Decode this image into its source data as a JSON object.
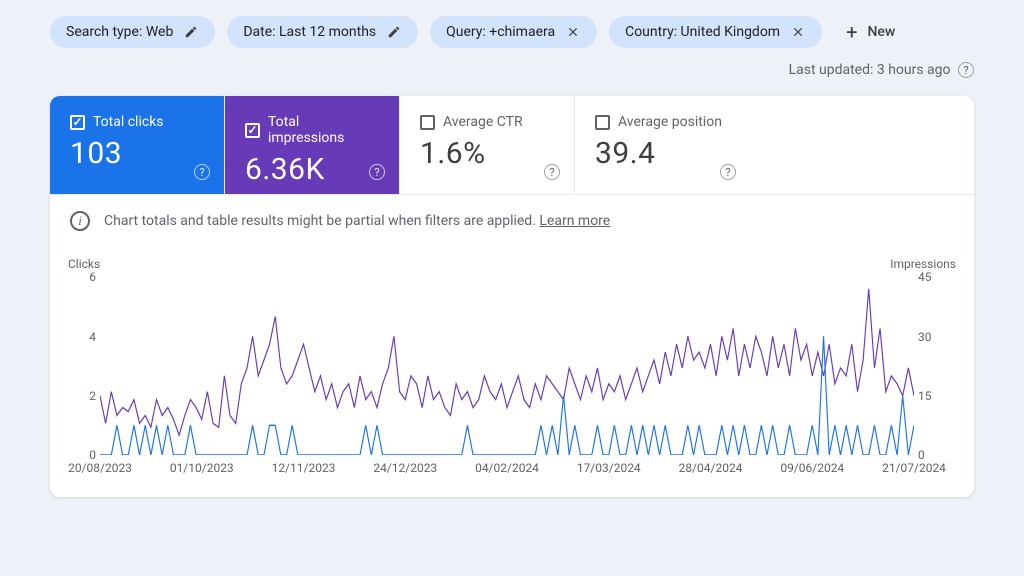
{
  "filters": [
    {
      "label": "Search type: Web",
      "icon": "edit"
    },
    {
      "label": "Date: Last 12 months",
      "icon": "edit"
    },
    {
      "label": "Query: +chimaera",
      "icon": "close"
    },
    {
      "label": "Country: United Kingdom",
      "icon": "close"
    }
  ],
  "new_btn": "New",
  "last_updated": "Last updated: 3 hours ago",
  "metrics": {
    "clicks": {
      "label": "Total clicks",
      "value": "103",
      "checked": true,
      "theme": "blue"
    },
    "impr": {
      "label": "Total impressions",
      "value": "6.36K",
      "checked": true,
      "theme": "purple"
    },
    "ctr": {
      "label": "Average CTR",
      "value": "1.6%",
      "checked": false,
      "theme": "white"
    },
    "position": {
      "label": "Average position",
      "value": "39.4",
      "checked": false,
      "theme": "white"
    }
  },
  "info_text": "Chart totals and table results might be partial when filters are applied.",
  "info_link": "Learn more",
  "chart_data": {
    "type": "line",
    "title": "",
    "y_left_label": "Clicks",
    "y_right_label": "Impressions",
    "y_left_ticks": [
      0,
      2,
      4,
      6
    ],
    "y_left_range": [
      0,
      6
    ],
    "y_right_ticks": [
      0,
      15,
      30,
      45
    ],
    "y_right_range": [
      0,
      45
    ],
    "x_ticks": [
      "20/08/2023",
      "01/10/2023",
      "12/11/2023",
      "24/12/2023",
      "04/02/2024",
      "17/03/2024",
      "28/04/2024",
      "09/06/2024",
      "21/07/2024"
    ],
    "series": [
      {
        "name": "Clicks",
        "axis": "left",
        "color": "#1a73e8",
        "values": [
          0,
          0,
          0,
          1,
          0,
          0,
          1,
          0,
          1,
          0,
          1,
          0,
          1,
          0,
          0,
          0,
          1,
          0,
          0,
          0,
          0,
          0,
          0,
          0,
          0,
          0,
          0,
          1,
          0,
          0,
          1,
          1,
          0,
          0,
          1,
          0,
          0,
          0,
          0,
          0,
          0,
          0,
          0,
          0,
          0,
          0,
          0,
          1,
          0,
          1,
          0,
          0,
          0,
          0,
          0,
          0,
          0,
          0,
          0,
          0,
          0,
          0,
          0,
          0,
          0,
          1,
          0,
          0,
          0,
          0,
          0,
          0,
          0,
          0,
          0,
          0,
          0,
          0,
          1,
          0,
          1,
          0,
          2,
          0,
          1,
          0,
          0,
          0,
          1,
          0,
          0,
          1,
          0,
          0,
          1,
          0,
          1,
          0,
          1,
          0,
          1,
          0,
          0,
          0,
          1,
          0,
          1,
          0,
          0,
          0,
          1,
          0,
          1,
          0,
          1,
          0,
          0,
          1,
          0,
          1,
          0,
          0,
          1,
          0,
          0,
          0,
          1,
          0,
          4,
          0,
          1,
          0,
          1,
          0,
          1,
          0,
          0,
          1,
          0,
          0,
          1,
          0,
          2,
          0,
          1
        ]
      },
      {
        "name": "Impressions",
        "axis": "right",
        "color": "#673ab7",
        "values": [
          15,
          8,
          16,
          10,
          12,
          11,
          14,
          8,
          10,
          7,
          14,
          10,
          12,
          9,
          5,
          10,
          14,
          12,
          9,
          16,
          8,
          7,
          20,
          10,
          8,
          18,
          22,
          30,
          20,
          24,
          28,
          35,
          22,
          18,
          20,
          24,
          28,
          22,
          16,
          20,
          14,
          18,
          12,
          16,
          18,
          12,
          20,
          14,
          16,
          12,
          18,
          22,
          30,
          16,
          14,
          20,
          18,
          12,
          20,
          14,
          16,
          12,
          10,
          18,
          14,
          16,
          12,
          14,
          20,
          16,
          14,
          18,
          12,
          16,
          20,
          14,
          12,
          18,
          14,
          20,
          18,
          16,
          14,
          22,
          18,
          14,
          20,
          16,
          22,
          14,
          18,
          16,
          20,
          14,
          18,
          22,
          16,
          20,
          24,
          18,
          26,
          20,
          28,
          22,
          30,
          24,
          26,
          22,
          28,
          20,
          30,
          24,
          32,
          20,
          28,
          22,
          30,
          26,
          20,
          30,
          22,
          28,
          20,
          32,
          24,
          28,
          20,
          26,
          20,
          28,
          18,
          22,
          20,
          28,
          16,
          24,
          42,
          22,
          32,
          16,
          20,
          18,
          15,
          22,
          15
        ]
      }
    ]
  }
}
